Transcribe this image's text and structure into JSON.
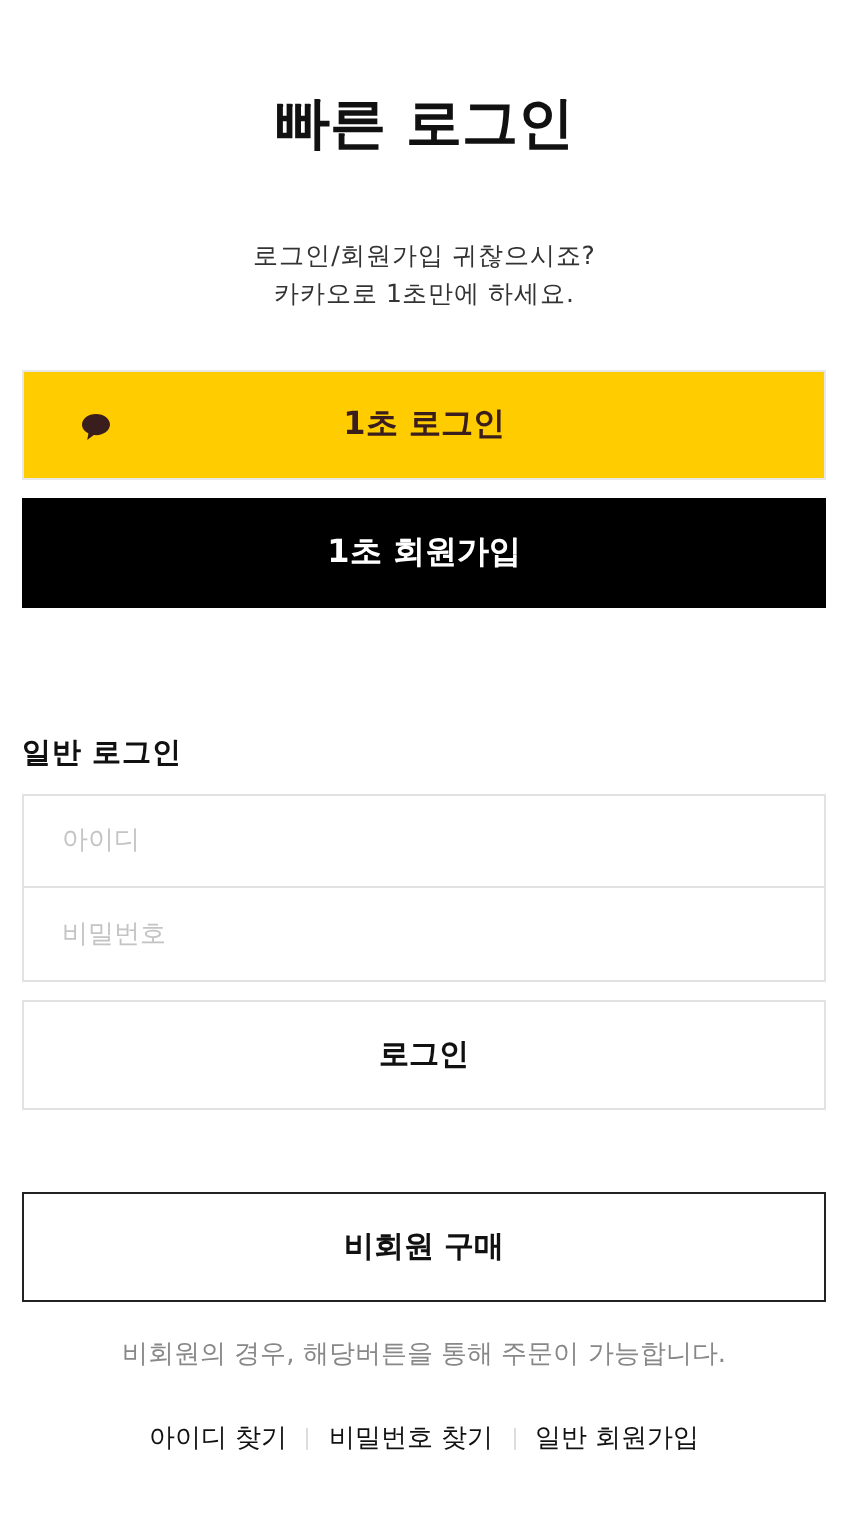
{
  "title": "빠른 로그인",
  "subtitle_lines": [
    "로그인/회원가입 귀찮으시죠?",
    "카카오로 1초만에 하세요."
  ],
  "kakao_login_button": "1초 로그인",
  "kakao_signup_button": "1초 회원가입",
  "section_title": "일반 로그인",
  "fields": [
    {
      "placeholder": "아이디"
    },
    {
      "placeholder": "비밀번호"
    }
  ],
  "login_button": "로그인",
  "guest_button": "비회원 구매",
  "guest_note": "비회원의 경우, 해당버튼을 통해 주문이 가능합니다.",
  "links": [
    "아이디 찾기",
    "비밀번호 찾기",
    "일반 회원가입"
  ]
}
